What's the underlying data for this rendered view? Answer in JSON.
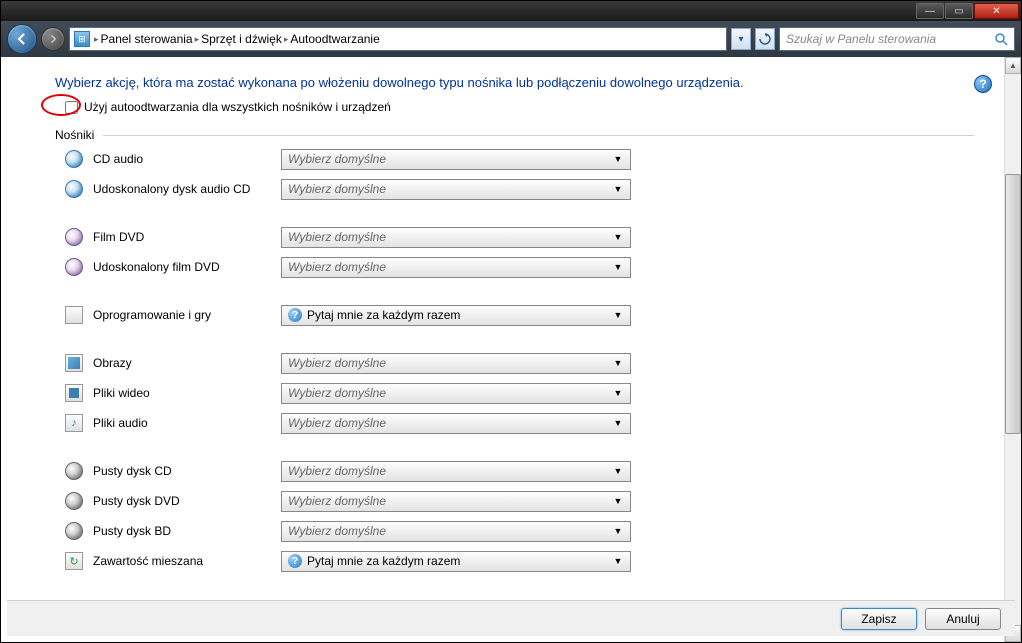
{
  "window": {
    "minimize": "—",
    "maximize": "▭",
    "close": "✕"
  },
  "toolbar": {
    "breadcrumb": {
      "item1": "Panel sterowania",
      "item2": "Sprzęt i dźwięk",
      "item3": "Autoodtwarzanie"
    },
    "search_placeholder": "Szukaj w Panelu sterowania"
  },
  "page": {
    "heading": "Wybierz akcję, która ma zostać wykonana po włożeniu dowolnego typu nośnika lub podłączeniu dowolnego urządzenia.",
    "checkbox_label": "Użyj autoodtwarzania dla wszystkich nośników i urządzeń",
    "group_label": "Nośniki",
    "placeholder": "Wybierz domyślne",
    "ask_each_time": "Pytaj mnie za każdym razem",
    "items": [
      {
        "label": "CD audio",
        "value": "placeholder",
        "icon": "disc"
      },
      {
        "label": "Udoskonalony dysk audio CD",
        "value": "placeholder",
        "icon": "disc",
        "gap": true
      },
      {
        "label": "Film DVD",
        "value": "placeholder",
        "icon": "dvd"
      },
      {
        "label": "Udoskonalony film DVD",
        "value": "placeholder",
        "icon": "dvd",
        "gap": true
      },
      {
        "label": "Oprogramowanie i gry",
        "value": "ask",
        "icon": "box",
        "gap": true
      },
      {
        "label": "Obrazy",
        "value": "placeholder",
        "icon": "pic"
      },
      {
        "label": "Pliki wideo",
        "value": "placeholder",
        "icon": "vid"
      },
      {
        "label": "Pliki audio",
        "value": "placeholder",
        "icon": "aud",
        "gap": true
      },
      {
        "label": "Pusty dysk CD",
        "value": "placeholder",
        "icon": "disc-grey"
      },
      {
        "label": "Pusty dysk DVD",
        "value": "placeholder",
        "icon": "disc-grey"
      },
      {
        "label": "Pusty dysk BD",
        "value": "placeholder",
        "icon": "disc-grey"
      },
      {
        "label": "Zawartość mieszana",
        "value": "ask",
        "icon": "mix"
      }
    ]
  },
  "footer": {
    "save": "Zapisz",
    "cancel": "Anuluj"
  }
}
